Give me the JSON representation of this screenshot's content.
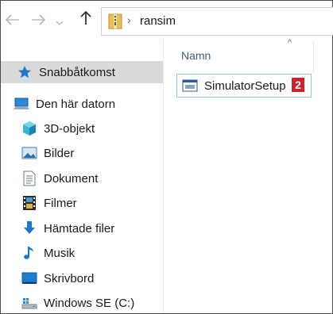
{
  "toolbar": {
    "back_icon": "arrow-left-icon",
    "forward_icon": "arrow-right-icon",
    "recent_icon": "chevron-down-icon",
    "up_icon": "arrow-up-icon"
  },
  "address_bar": {
    "folder_icon": "zip-folder-icon",
    "separator": "›",
    "path": "ransim"
  },
  "sidebar": {
    "items": [
      {
        "label": "Snabbåtkomst",
        "icon": "star-icon"
      },
      {
        "label": "Den här datorn",
        "icon": "computer-icon"
      },
      {
        "label": "3D-objekt",
        "icon": "cube-icon"
      },
      {
        "label": "Bilder",
        "icon": "picture-icon"
      },
      {
        "label": "Dokument",
        "icon": "document-icon"
      },
      {
        "label": "Filmer",
        "icon": "film-icon"
      },
      {
        "label": "Hämtade filer",
        "icon": "download-icon"
      },
      {
        "label": "Musik",
        "icon": "music-icon"
      },
      {
        "label": "Skrivbord",
        "icon": "desktop-icon"
      },
      {
        "label": "Windows SE (C:)",
        "icon": "drive-icon"
      }
    ]
  },
  "content": {
    "column_header": "Namn",
    "sort_indicator": "^",
    "files": [
      {
        "name": "SimulatorSetup",
        "icon": "installer-icon"
      }
    ],
    "badge": "2"
  },
  "colors": {
    "selected_bg": "#d9d9d9",
    "hover_border": "#99c6f0",
    "badge": "#c8232c",
    "star": "#1e78c8"
  }
}
